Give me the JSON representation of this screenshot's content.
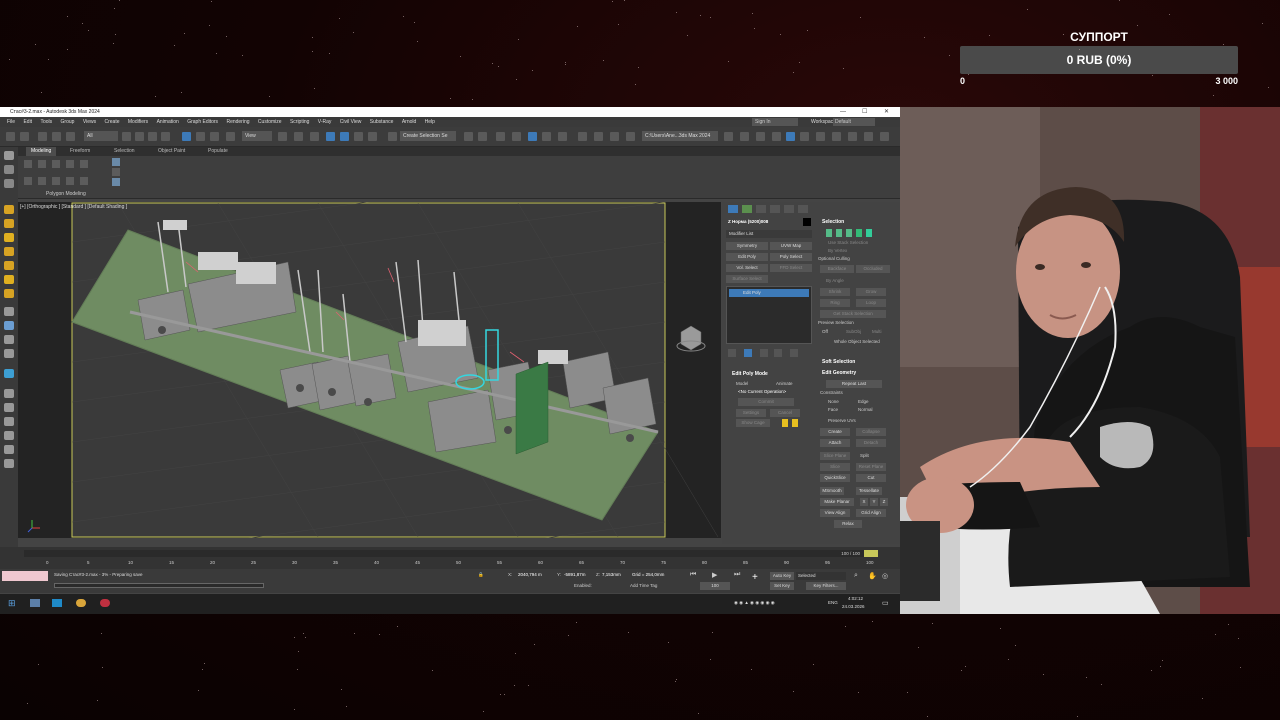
{
  "donation": {
    "title": "СУППОРТ",
    "amount": "0 RUB (0%)",
    "min": "0",
    "max": "3 000",
    "progress": 0
  },
  "window": {
    "title": "Стас#3-2.max - Autodesk 3ds Max 2024",
    "menu": [
      "File",
      "Edit",
      "Tools",
      "Group",
      "Views",
      "Create",
      "Modifiers",
      "Animation",
      "Graph Editors",
      "Rendering",
      "Customize",
      "Scripting",
      "V-Ray",
      "Civil View",
      "Substance",
      "Arnold",
      "Help"
    ],
    "signin": "Sign In",
    "workspaces_label": "Workspaces:",
    "workspaces_value": "Default",
    "selection_set": "Create Selection Se",
    "path": "C:\\Users\\Ane...3ds Max 2024",
    "view_dropdown": "View",
    "all_dropdown": "All"
  },
  "ribbon": {
    "tabs": [
      "Modeling",
      "Freeform",
      "Selection",
      "Object Paint",
      "Populate"
    ],
    "group_label": "Polygon Modeling"
  },
  "viewport": {
    "label": "[+] [Orthographic ] [Standard ] [Default Shading ]"
  },
  "command_panel": {
    "object_name": "Z Норма (5200)008",
    "modifier_list": "Modifier List",
    "buttons": [
      "Symmetry",
      "UVW Map",
      "Edit Poly",
      "Poly Select",
      "Vol. Select",
      "FFD Select",
      "Surface Select"
    ],
    "stack_item": "Edit Poly",
    "edit_poly_mode": "Edit Poly Mode",
    "model": "Model",
    "animate": "Animate",
    "no_op": "<No Current Operation>",
    "commit": "Commit",
    "settings": "Settings",
    "cancel": "Cancel",
    "show_cage": "Show Cage",
    "selection": "Selection",
    "use_stack": "Use Stack Selection",
    "by_vertex": "By Vertex",
    "ignore_backfacing": "Ignore Backfacing",
    "optional_culling": "Optional Culling",
    "backface": "Backface",
    "occluded": "Occluded",
    "by_angle": "By Angle",
    "shrink": "Shrink",
    "grow": "Grow",
    "ring": "Ring",
    "loop": "Loop",
    "get_stack": "Get Stack Selection",
    "preview_selection": "Preview Selection",
    "off": "Off",
    "subobj": "SubObj",
    "multi": "Multi",
    "whole_object": "Whole Object Selected",
    "soft_selection": "Soft Selection",
    "edit_geometry": "Edit Geometry",
    "repeat_last": "Repeat Last",
    "constraints": "Constraints",
    "none": "None",
    "edge": "Edge",
    "face": "Face",
    "normal": "Normal",
    "preserve_uvs": "Preserve UVs",
    "create": "Create",
    "collapse": "Collapse",
    "attach": "Attach",
    "detach": "Detach",
    "slice_plane": "Slice Plane",
    "split": "Split",
    "slice": "Slice",
    "reset_plane": "Reset Plane",
    "quickslice": "QuickSlice",
    "cut": "Cut",
    "msmooth": "MSmooth",
    "tessellate": "Tessellate",
    "make_planar": "Make Planar",
    "x": "X",
    "y": "Y",
    "z": "Z",
    "view_align": "View Align",
    "grid_align": "Grid Align",
    "relax": "Relax"
  },
  "timeline": {
    "frame": "100 / 100",
    "ticks": [
      "0",
      "5",
      "10",
      "15",
      "20",
      "25",
      "30",
      "35",
      "40",
      "45",
      "50",
      "55",
      "60",
      "65",
      "70",
      "75",
      "80",
      "85",
      "90",
      "95",
      "100"
    ]
  },
  "status": {
    "message": "Saving Стас#3-2.max - 3% - Preparing save",
    "x": "2040,794 m",
    "y": "-5891,87m",
    "z": "7,153mm",
    "grid": "Grid = 254,0mm",
    "enabled": "Enabled:",
    "add_time_tag": "Add Time Tag",
    "autokey": "Auto Key",
    "selected": "Selected",
    "setkey": "Set Key",
    "key_filters": "Key Filters...",
    "frame_value": "100"
  },
  "taskbar": {
    "lang": "ENG",
    "time": "4:02:12",
    "date": "24.03.2026"
  }
}
